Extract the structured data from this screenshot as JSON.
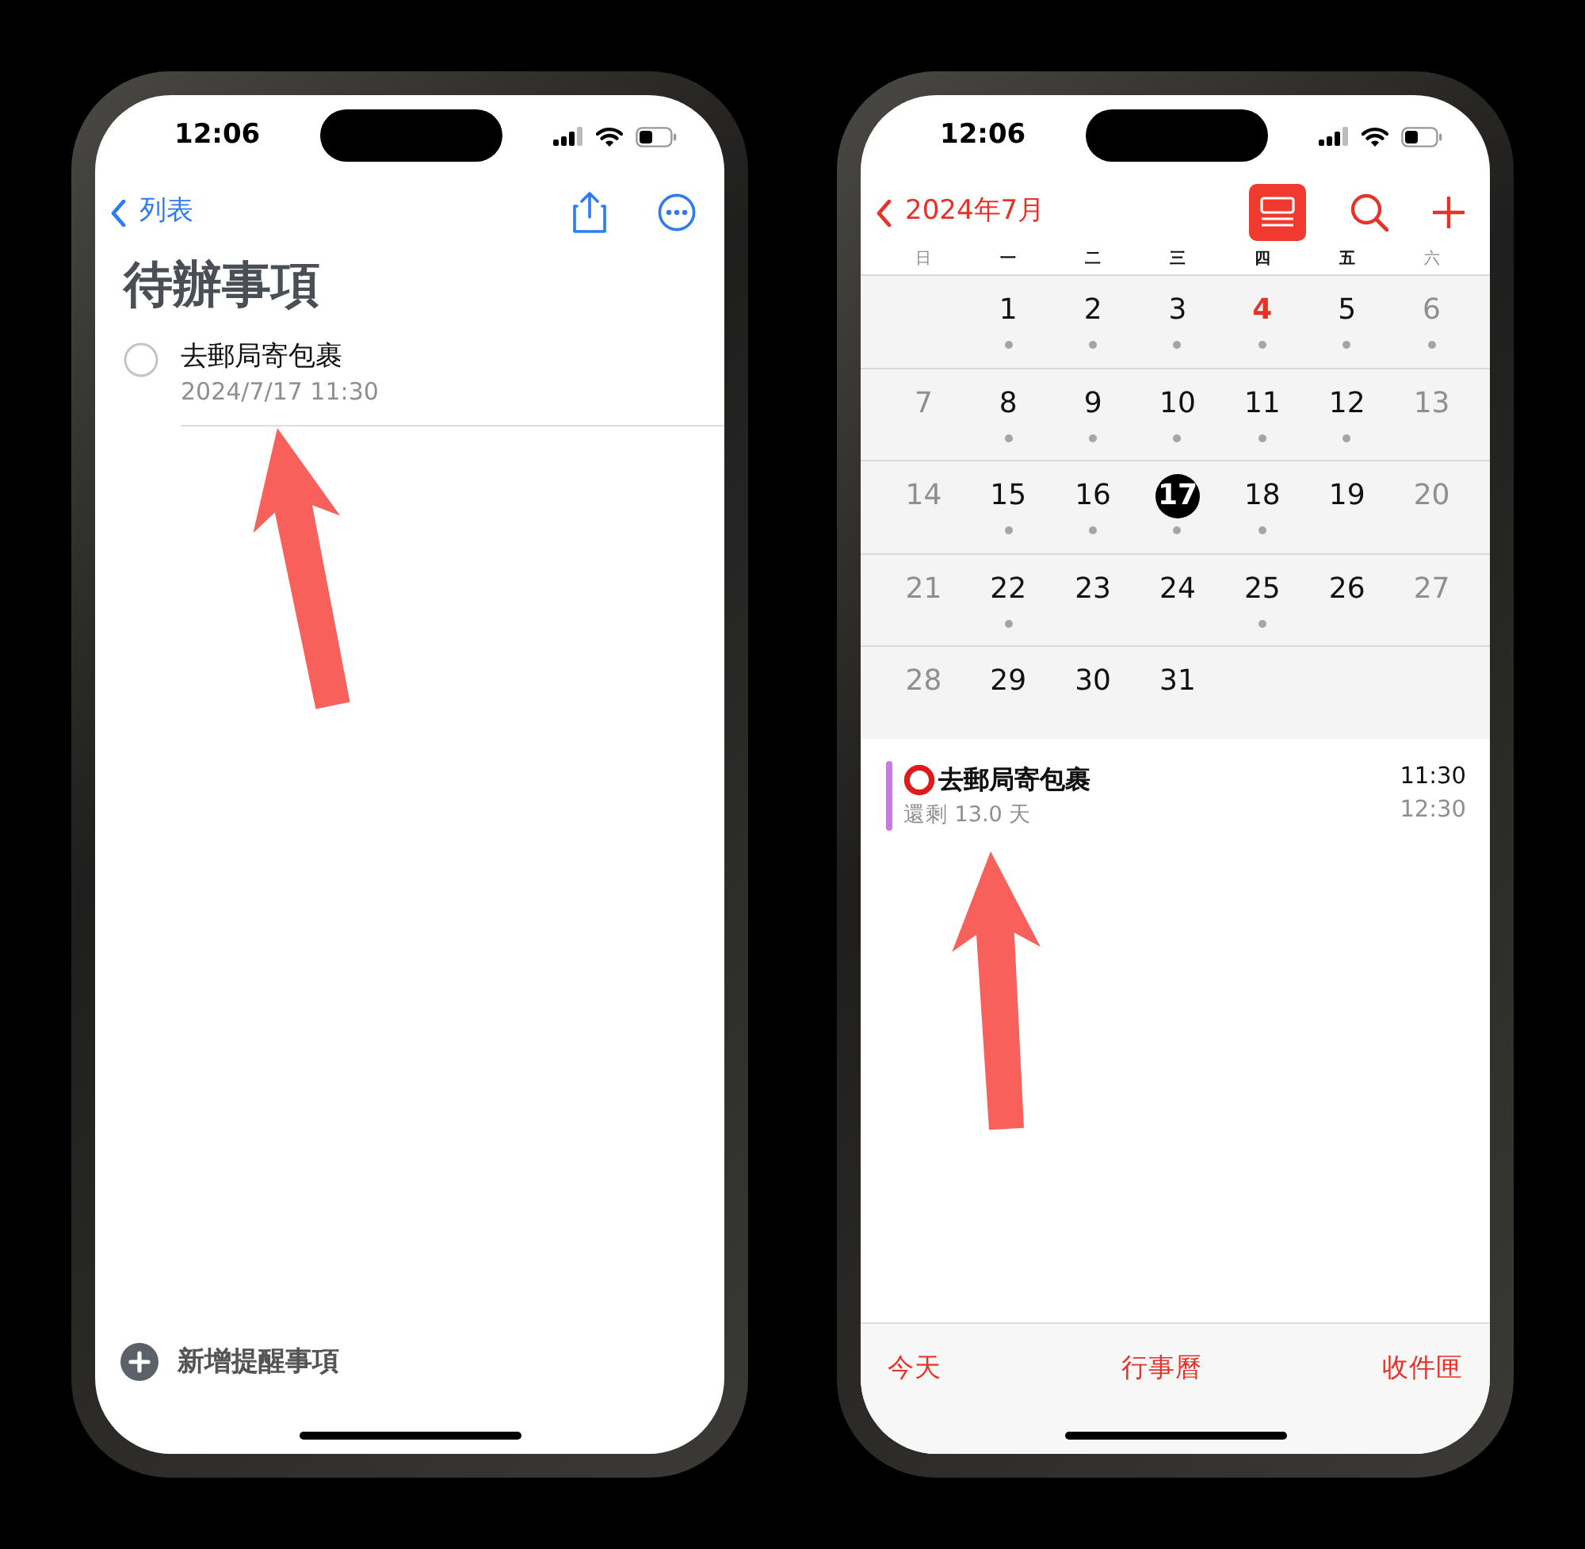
{
  "phones": [
    {
      "kind": "reminders",
      "status_time": "12:06",
      "back_label": "列表",
      "title": "待辦事項",
      "reminders": [
        {
          "title": "去郵局寄包裹",
          "due": "2024/7/17 11:30",
          "checked": false
        }
      ],
      "add_label": "新增提醒事項"
    },
    {
      "kind": "calendar",
      "status_time": "12:06",
      "back_label": "2024年7月",
      "list_view_selected": true,
      "weekdays": [
        {
          "label": "日",
          "dimmed": true
        },
        {
          "label": "一",
          "dimmed": false
        },
        {
          "label": "二",
          "dimmed": false
        },
        {
          "label": "三",
          "dimmed": false
        },
        {
          "label": "四",
          "dimmed": false
        },
        {
          "label": "五",
          "dimmed": false
        },
        {
          "label": "六",
          "dimmed": true
        }
      ],
      "weeks": [
        {
          "starts_mid_week": true,
          "days": [
            {
              "day": "1",
              "dimmed": false,
              "holiday": false,
              "selected": false,
              "event_dot": true
            },
            {
              "day": "2",
              "dimmed": false,
              "holiday": false,
              "selected": false,
              "event_dot": true
            },
            {
              "day": "3",
              "dimmed": false,
              "holiday": false,
              "selected": false,
              "event_dot": true
            },
            {
              "day": "4",
              "dimmed": false,
              "holiday": true,
              "selected": false,
              "event_dot": true
            },
            {
              "day": "5",
              "dimmed": false,
              "holiday": false,
              "selected": false,
              "event_dot": true
            },
            {
              "day": "6",
              "dimmed": true,
              "holiday": false,
              "selected": false,
              "event_dot": true
            }
          ]
        },
        {
          "starts_mid_week": false,
          "days": [
            {
              "day": "7",
              "dimmed": true,
              "holiday": false,
              "selected": false,
              "event_dot": false
            },
            {
              "day": "8",
              "dimmed": false,
              "holiday": false,
              "selected": false,
              "event_dot": true
            },
            {
              "day": "9",
              "dimmed": false,
              "holiday": false,
              "selected": false,
              "event_dot": true
            },
            {
              "day": "10",
              "dimmed": false,
              "holiday": false,
              "selected": false,
              "event_dot": true
            },
            {
              "day": "11",
              "dimmed": false,
              "holiday": false,
              "selected": false,
              "event_dot": true
            },
            {
              "day": "12",
              "dimmed": false,
              "holiday": false,
              "selected": false,
              "event_dot": true
            },
            {
              "day": "13",
              "dimmed": true,
              "holiday": false,
              "selected": false,
              "event_dot": false
            }
          ]
        },
        {
          "starts_mid_week": false,
          "days": [
            {
              "day": "14",
              "dimmed": true,
              "holiday": false,
              "selected": false,
              "event_dot": false
            },
            {
              "day": "15",
              "dimmed": false,
              "holiday": false,
              "selected": false,
              "event_dot": true
            },
            {
              "day": "16",
              "dimmed": false,
              "holiday": false,
              "selected": false,
              "event_dot": true
            },
            {
              "day": "17",
              "dimmed": false,
              "holiday": false,
              "selected": true,
              "event_dot": true
            },
            {
              "day": "18",
              "dimmed": false,
              "holiday": false,
              "selected": false,
              "event_dot": true
            },
            {
              "day": "19",
              "dimmed": false,
              "holiday": false,
              "selected": false,
              "event_dot": false
            },
            {
              "day": "20",
              "dimmed": true,
              "holiday": false,
              "selected": false,
              "event_dot": false
            }
          ]
        },
        {
          "starts_mid_week": false,
          "days": [
            {
              "day": "21",
              "dimmed": true,
              "holiday": false,
              "selected": false,
              "event_dot": false
            },
            {
              "day": "22",
              "dimmed": false,
              "holiday": false,
              "selected": false,
              "event_dot": true
            },
            {
              "day": "23",
              "dimmed": false,
              "holiday": false,
              "selected": false,
              "event_dot": false
            },
            {
              "day": "24",
              "dimmed": false,
              "holiday": false,
              "selected": false,
              "event_dot": false
            },
            {
              "day": "25",
              "dimmed": false,
              "holiday": false,
              "selected": false,
              "event_dot": true
            },
            {
              "day": "26",
              "dimmed": false,
              "holiday": false,
              "selected": false,
              "event_dot": false
            },
            {
              "day": "27",
              "dimmed": true,
              "holiday": false,
              "selected": false,
              "event_dot": false
            }
          ]
        },
        {
          "starts_mid_week": false,
          "days": [
            {
              "day": "28",
              "dimmed": true,
              "holiday": false,
              "selected": false,
              "event_dot": false
            },
            {
              "day": "29",
              "dimmed": false,
              "holiday": false,
              "selected": false,
              "event_dot": false
            },
            {
              "day": "30",
              "dimmed": false,
              "holiday": false,
              "selected": false,
              "event_dot": false
            },
            {
              "day": "31",
              "dimmed": false,
              "holiday": false,
              "selected": false,
              "event_dot": false
            }
          ]
        }
      ],
      "events": [
        {
          "title": "去郵局寄包裹",
          "subtitle": "還剩 13.0 天",
          "start": "11:30",
          "end": "12:30",
          "color": "#c77be0"
        }
      ],
      "tabs": [
        "今天",
        "行事曆",
        "收件匣"
      ]
    }
  ]
}
